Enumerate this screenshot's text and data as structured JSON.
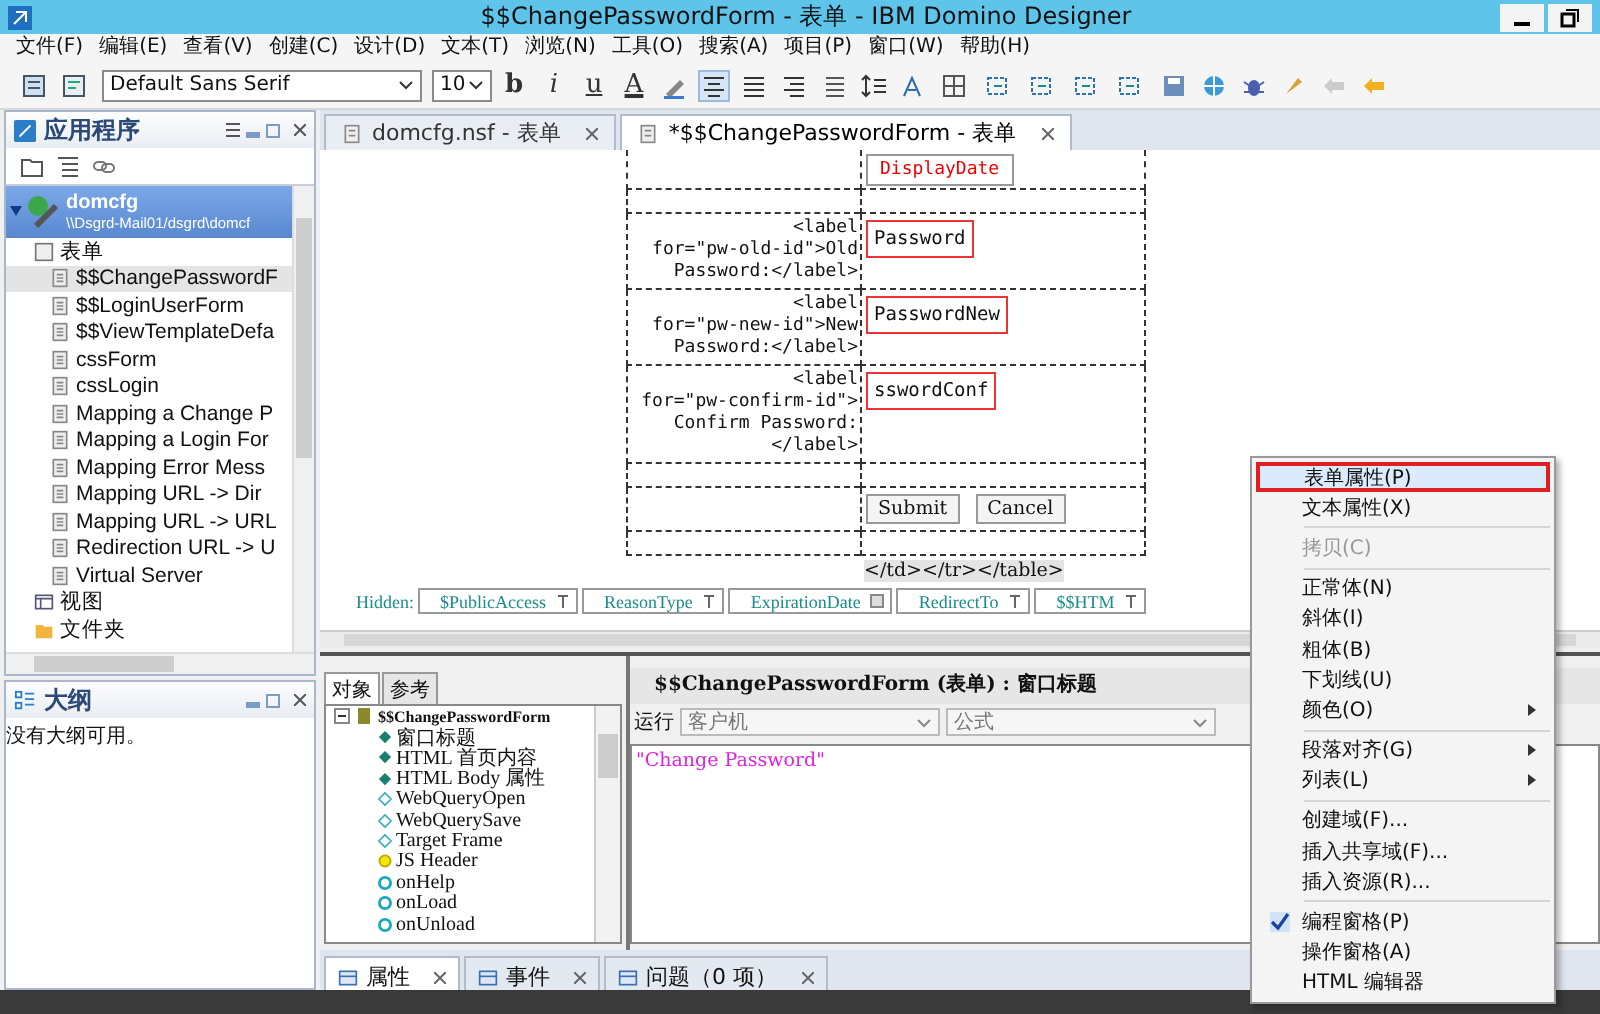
{
  "window": {
    "title": "$$ChangePasswordForm - 表单 - IBM Domino Designer"
  },
  "menu_bar": [
    "文件(F)",
    "编辑(E)",
    "查看(V)",
    "创建(C)",
    "设计(D)",
    "文本(T)",
    "浏览(N)",
    "工具(O)",
    "搜索(A)",
    "项目(P)",
    "窗口(W)",
    "帮助(H)"
  ],
  "toolbar": {
    "font": "Default Sans Serif",
    "size": "10",
    "format_glyphs": [
      "b",
      "i",
      "u",
      "A"
    ]
  },
  "applications_panel": {
    "title": "应用程序",
    "database": {
      "name": "domcfg",
      "path": "\\\\Dsgrd-Mail01/dsgrd\\domcf",
      "selected": true,
      "expanded": true
    },
    "groups": [
      {
        "label": "表单",
        "kind": "form",
        "children": [
          {
            "label": "$$ChangePasswordF",
            "selected": true
          },
          {
            "label": "$$LoginUserForm",
            "selected": false
          },
          {
            "label": "$$ViewTemplateDefa",
            "selected": false
          },
          {
            "label": "cssForm",
            "selected": false
          },
          {
            "label": "cssLogin",
            "selected": false
          },
          {
            "label": "Mapping a Change P",
            "selected": false
          },
          {
            "label": "Mapping a Login For",
            "selected": false
          },
          {
            "label": "Mapping Error Mess",
            "selected": false
          },
          {
            "label": "Mapping URL -> Dir",
            "selected": false
          },
          {
            "label": "Mapping URL -> URL",
            "selected": false
          },
          {
            "label": "Redirection URL -> U",
            "selected": false
          },
          {
            "label": "Virtual Server",
            "selected": false
          }
        ]
      },
      {
        "label": "视图",
        "kind": "view"
      },
      {
        "label": "文件夹",
        "kind": "folder"
      }
    ]
  },
  "outline_panel": {
    "title": "大纲",
    "message": "没有大纲可用。"
  },
  "editor_tabs": [
    {
      "label": "domcfg.nsf - 表单",
      "selected": false
    },
    {
      "label": "*$$ChangePasswordForm - 表单",
      "selected": true
    }
  ],
  "form": {
    "date_field": "DisplayDate",
    "rows": [
      {
        "label_lines": [
          "<label",
          "for=\"pw-old-id\">Old",
          "Password:</label>"
        ],
        "field": "Password"
      },
      {
        "label_lines": [
          "<label",
          "for=\"pw-new-id\">New",
          "Password:</label>"
        ],
        "field": "PasswordNew"
      },
      {
        "label_lines": [
          "<label",
          "for=\"pw-confirm-id\">",
          "Confirm Password:",
          "</label>"
        ],
        "field": "sswordConf"
      }
    ],
    "buttons": [
      "Submit",
      "Cancel"
    ],
    "closing_tags": "</td></tr></table>",
    "hidden_label": "Hidden:",
    "hidden_fields": [
      {
        "name": "$PublicAccess",
        "kind": "text"
      },
      {
        "name": "ReasonType",
        "kind": "text"
      },
      {
        "name": "ExpirationDate",
        "kind": "date"
      },
      {
        "name": "RedirectTo",
        "kind": "text"
      },
      {
        "name": "$$HTM",
        "kind": "text"
      }
    ]
  },
  "objects_panel": {
    "tabs": [
      {
        "label": "对象",
        "selected": true
      },
      {
        "label": "参考",
        "selected": false
      }
    ],
    "root": {
      "label": "$$ChangePasswordForm",
      "expanded": true
    },
    "items": [
      {
        "label": "窗口标题",
        "kind": "set"
      },
      {
        "label": "HTML 首页内容",
        "kind": "set"
      },
      {
        "label": "HTML Body 属性",
        "kind": "set"
      },
      {
        "label": "WebQueryOpen",
        "kind": "empty"
      },
      {
        "label": "WebQuerySave",
        "kind": "empty"
      },
      {
        "label": "Target Frame",
        "kind": "empty"
      },
      {
        "label": "JS Header",
        "kind": "script"
      },
      {
        "label": "onHelp",
        "kind": "event"
      },
      {
        "label": "onLoad",
        "kind": "event"
      },
      {
        "label": "onUnload",
        "kind": "event"
      }
    ]
  },
  "script_panel": {
    "header": "$$ChangePasswordForm (表单) : 窗口标题",
    "run_label": "运行",
    "run_target": "客户机",
    "language": "公式",
    "code": "\"Change Password\""
  },
  "bottom_tabs": [
    {
      "label": "属性",
      "selected": true
    },
    {
      "label": "事件",
      "selected": false
    },
    {
      "label": "问题（0 项）",
      "selected": false
    }
  ],
  "context_menu": [
    {
      "kind": "item",
      "label": "表单属性(P)",
      "selected": true,
      "disabled": false,
      "checked": false,
      "submenu": false
    },
    {
      "kind": "item",
      "label": "文本属性(X)",
      "selected": false,
      "disabled": false,
      "checked": false,
      "submenu": false
    },
    {
      "kind": "separator"
    },
    {
      "kind": "item",
      "label": "拷贝(C)",
      "selected": false,
      "disabled": true,
      "checked": false,
      "submenu": false
    },
    {
      "kind": "separator"
    },
    {
      "kind": "item",
      "label": "正常体(N)",
      "selected": false,
      "disabled": false,
      "checked": false,
      "submenu": false
    },
    {
      "kind": "item",
      "label": "斜体(I)",
      "selected": false,
      "disabled": false,
      "checked": false,
      "submenu": false
    },
    {
      "kind": "item",
      "label": "粗体(B)",
      "selected": false,
      "disabled": false,
      "checked": false,
      "submenu": false
    },
    {
      "kind": "item",
      "label": "下划线(U)",
      "selected": false,
      "disabled": false,
      "checked": false,
      "submenu": false
    },
    {
      "kind": "item",
      "label": "颜色(O)",
      "selected": false,
      "disabled": false,
      "checked": false,
      "submenu": true
    },
    {
      "kind": "separator"
    },
    {
      "kind": "item",
      "label": "段落对齐(G)",
      "selected": false,
      "disabled": false,
      "checked": false,
      "submenu": true
    },
    {
      "kind": "item",
      "label": "列表(L)",
      "selected": false,
      "disabled": false,
      "checked": false,
      "submenu": true
    },
    {
      "kind": "separator"
    },
    {
      "kind": "item",
      "label": "创建域(F)...",
      "selected": false,
      "disabled": false,
      "checked": false,
      "submenu": false
    },
    {
      "kind": "item",
      "label": "插入共享域(F)...",
      "selected": false,
      "disabled": false,
      "checked": false,
      "submenu": false
    },
    {
      "kind": "item",
      "label": "插入资源(R)...",
      "selected": false,
      "disabled": false,
      "checked": false,
      "submenu": false
    },
    {
      "kind": "separator"
    },
    {
      "kind": "item",
      "label": "编程窗格(P)",
      "selected": false,
      "disabled": false,
      "checked": true,
      "submenu": false
    },
    {
      "kind": "item",
      "label": "操作窗格(A)",
      "selected": false,
      "disabled": false,
      "checked": false,
      "submenu": false
    },
    {
      "kind": "item",
      "label": "HTML 编辑器",
      "selected": false,
      "disabled": false,
      "checked": false,
      "submenu": false
    }
  ]
}
